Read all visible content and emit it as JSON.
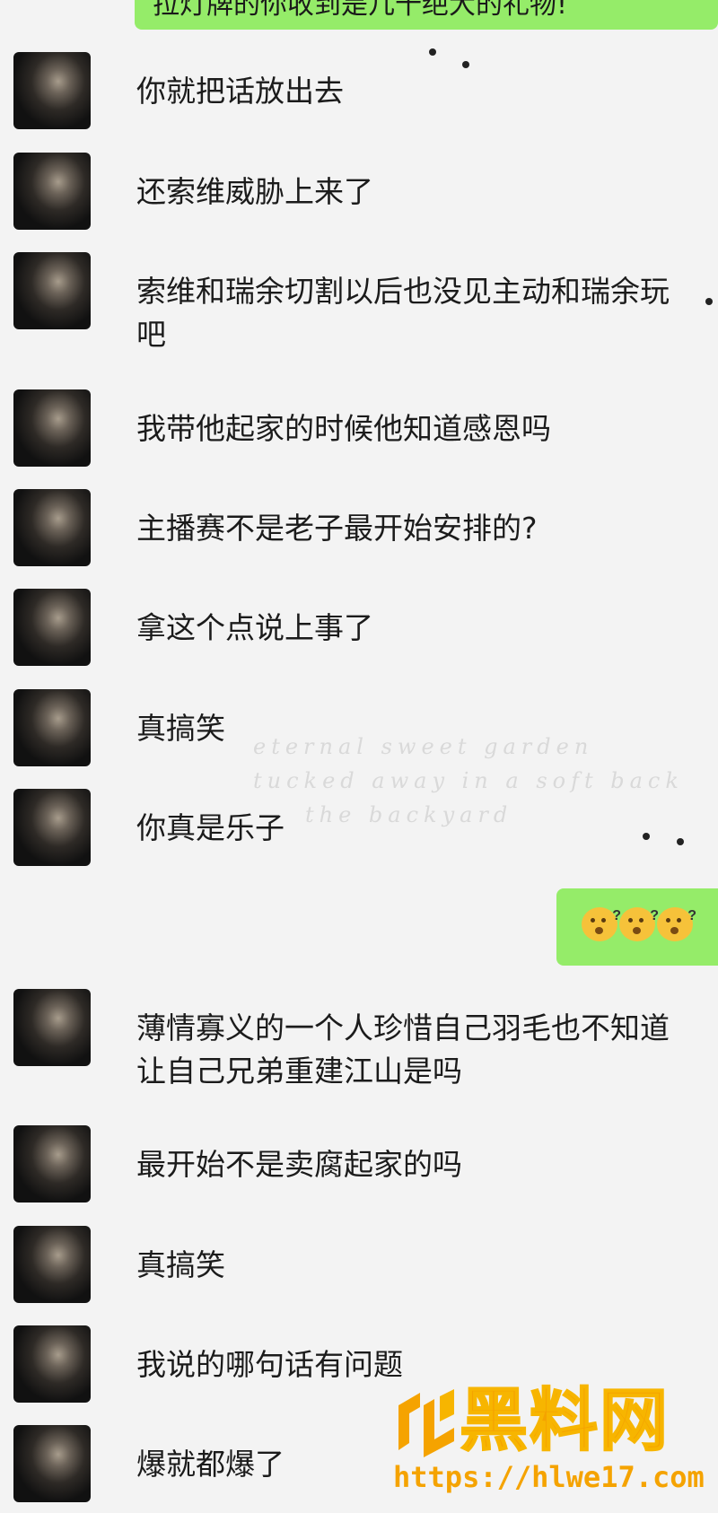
{
  "chat": {
    "top_bubble_text": "拉灯牌的你收到是几十绝大的礼物!",
    "messages": [
      {
        "text": "你就把话放出去"
      },
      {
        "text": "还索维威胁上来了"
      },
      {
        "text": "索维和瑞余切割以后也没见主动和瑞余玩吧"
      },
      {
        "text": "我带他起家的时候他知道感恩吗"
      },
      {
        "text": "主播赛不是老子最开始安排的?"
      },
      {
        "text": "拿这个点说上事了"
      },
      {
        "text": "真搞笑"
      },
      {
        "text": "你真是乐子"
      },
      {
        "text": "薄情寡义的一个人珍惜自己羽毛也不知道让自己兄弟重建江山是吗"
      },
      {
        "text": "最开始不是卖腐起家的吗"
      },
      {
        "text": "真搞笑"
      },
      {
        "text": "我说的哪句话有问题"
      },
      {
        "text": "爆就都爆了"
      }
    ],
    "reply_emojis": [
      "puzzled-face",
      "puzzled-face",
      "puzzled-face"
    ],
    "faint_background_text": [
      "eternal sweet garden",
      "tucked away in a soft back",
      "the backyard"
    ]
  },
  "watermark": {
    "title": "黑料网",
    "url": "https://hlwe17.com",
    "color": "#f5a300"
  },
  "colors": {
    "self_bubble": "#95ec69",
    "background": "#f3f3f3"
  }
}
